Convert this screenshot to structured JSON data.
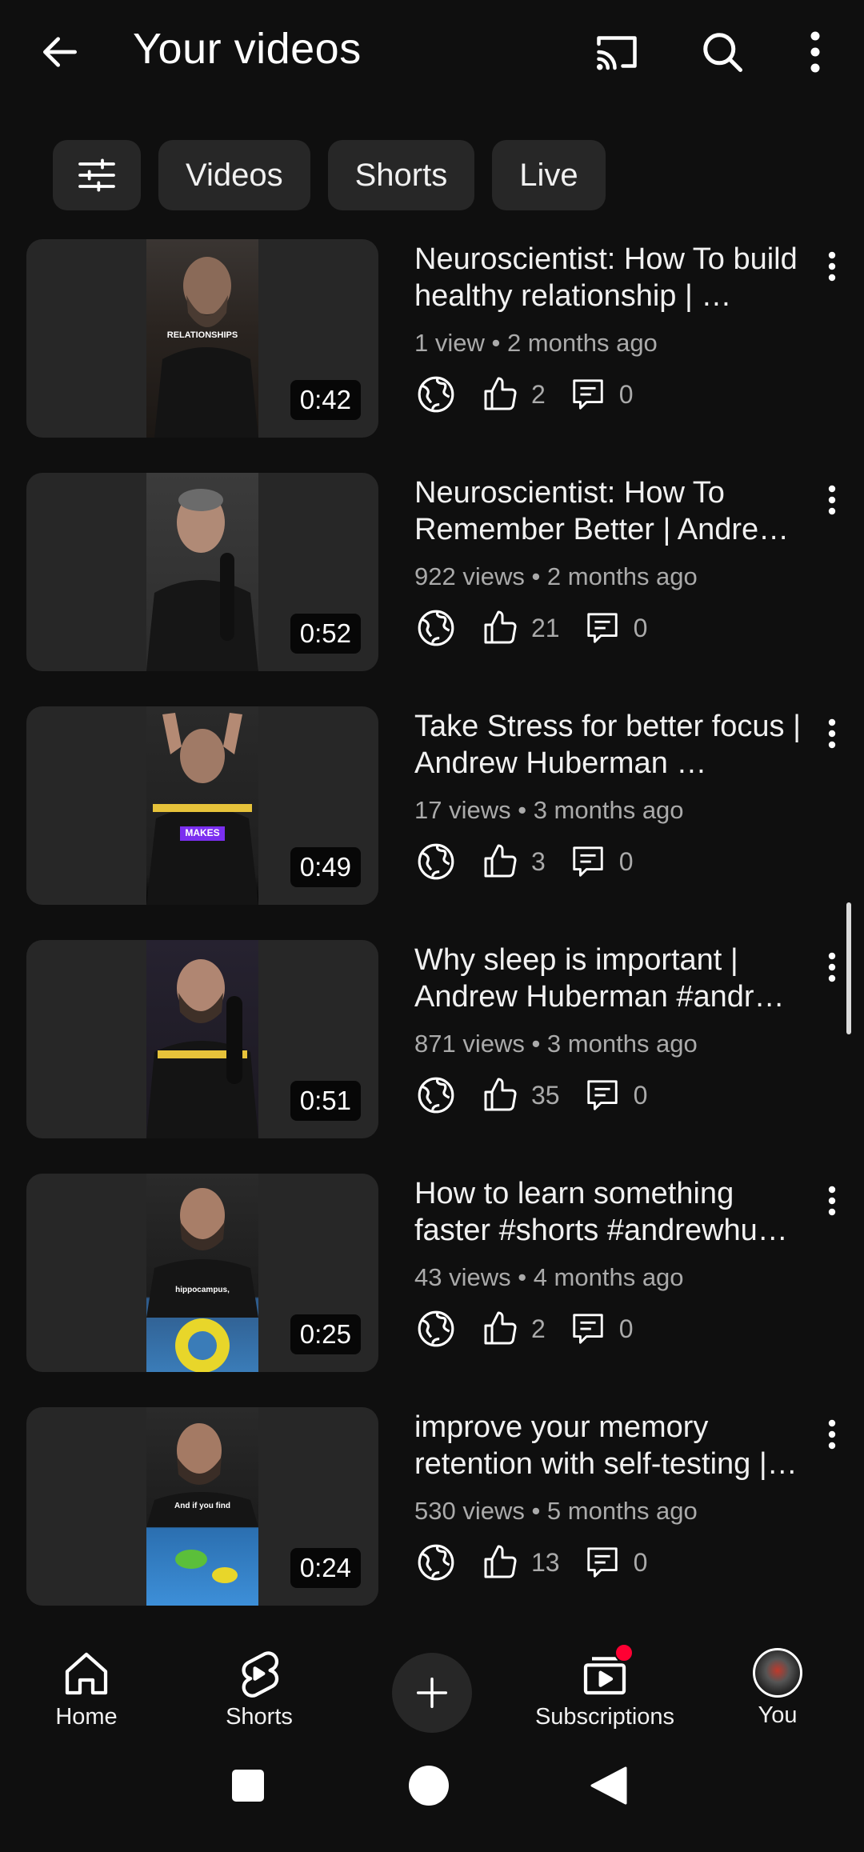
{
  "header": {
    "title": "Your videos"
  },
  "chips": [
    "Videos",
    "Shorts",
    "Live"
  ],
  "videos": [
    {
      "title": "Neuroscientist: How To build healthy relationship | …",
      "meta": "1 view • 2 months ago",
      "likes": "2",
      "comments": "0",
      "duration": "0:42",
      "overlay_text": "RELATIONSHIPS"
    },
    {
      "title": "Neuroscientist: How To Remember Better | Andre…",
      "meta": "922 views • 2 months ago",
      "likes": "21",
      "comments": "0",
      "duration": "0:52",
      "overlay_text": ""
    },
    {
      "title": "Take Stress for better focus | Andrew Huberman …",
      "meta": "17 views • 3 months ago",
      "likes": "3",
      "comments": "0",
      "duration": "0:49",
      "overlay_text": "MAKES"
    },
    {
      "title": "Why sleep is important | Andrew Huberman #andr…",
      "meta": "871 views • 3 months ago",
      "likes": "35",
      "comments": "0",
      "duration": "0:51",
      "overlay_text": ""
    },
    {
      "title": "How to learn something faster #shorts #andrewhu…",
      "meta": "43 views • 4 months ago",
      "likes": "2",
      "comments": "0",
      "duration": "0:25",
      "overlay_text": "hippocampus,"
    },
    {
      "title": "improve your memory retention with self-testing |…",
      "meta": "530 views • 5 months ago",
      "likes": "13",
      "comments": "0",
      "duration": "0:24",
      "overlay_text": "And if you find"
    }
  ],
  "bottom_nav": {
    "home": "Home",
    "shorts": "Shorts",
    "subscriptions": "Subscriptions",
    "you": "You"
  },
  "icons": {
    "back": "arrow-left-icon",
    "cast": "cast-icon",
    "search": "search-icon",
    "more": "more-vert-icon",
    "filter": "sliders-icon",
    "visibility": "globe-icon",
    "likes": "thumbs-up-icon",
    "comments": "comment-icon"
  },
  "colors": {
    "background": "#0f0f0f",
    "chip": "#272727",
    "notification": "#ff0033"
  }
}
